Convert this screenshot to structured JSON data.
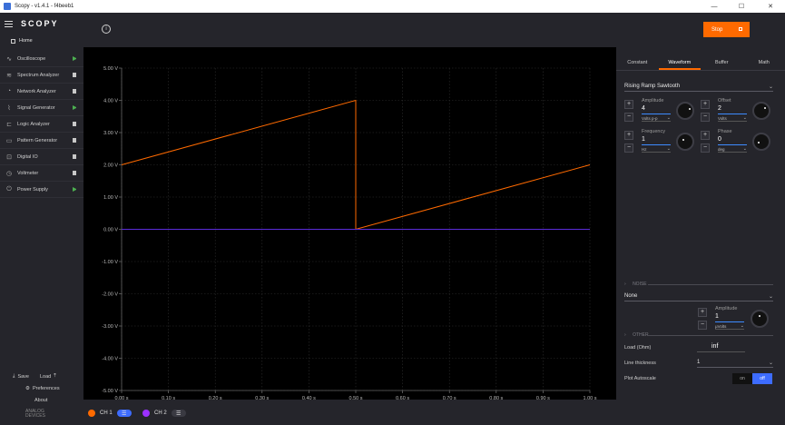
{
  "window": {
    "title": "Scopy - v1.4.1 - f4beeb1",
    "minimize": "—",
    "maximize": "☐",
    "close": "✕"
  },
  "sidebar": {
    "logo": "SCOPY",
    "home": "Home",
    "tools": [
      {
        "label": "Oscilloscope",
        "icon": "oscilloscope-icon",
        "status": "running"
      },
      {
        "label": "Spectrum Analyzer",
        "icon": "spectrum-icon",
        "status": "stopped"
      },
      {
        "label": "Network Analyzer",
        "icon": "network-icon",
        "status": "stopped"
      },
      {
        "label": "Signal Generator",
        "icon": "signal-icon",
        "status": "running"
      },
      {
        "label": "Logic Analyzer",
        "icon": "logic-icon",
        "status": "stopped"
      },
      {
        "label": "Pattern Generator",
        "icon": "pattern-icon",
        "status": "stopped"
      },
      {
        "label": "Digital IO",
        "icon": "digital-io-icon",
        "status": "stopped"
      },
      {
        "label": "Voltmeter",
        "icon": "voltmeter-icon",
        "status": "stopped"
      },
      {
        "label": "Power Supply",
        "icon": "power-icon",
        "status": "running"
      }
    ],
    "save": "Save",
    "load": "Load",
    "preferences": "Preferences",
    "about": "About",
    "brand_line1": "ANALOG",
    "brand_line2": "DEVICES"
  },
  "toolbar": {
    "stop_label": "Stop"
  },
  "chart_data": {
    "type": "line",
    "title": "",
    "xlabel": "",
    "ylabel": "",
    "xlim": [
      0,
      1.0
    ],
    "ylim": [
      -5,
      5
    ],
    "grid": true,
    "x_ticks": [
      "0.00 s",
      "0.10 s",
      "0.20 s",
      "0.30 s",
      "0.40 s",
      "0.50 s",
      "0.60 s",
      "0.70 s",
      "0.80 s",
      "0.90 s",
      "1.00 s"
    ],
    "y_ticks": [
      "5.00 V",
      "4.00 V",
      "3.00 V",
      "2.00 V",
      "1.00 V",
      "0.00 V",
      "-1.00 V",
      "-2.00 V",
      "-3.00 V",
      "-4.00 V",
      "-5.00 V"
    ],
    "series": [
      {
        "color": "#ff6a00",
        "x": [
          0,
          0.5,
          0.5,
          1.0
        ],
        "y": [
          2,
          4,
          0,
          2
        ]
      },
      {
        "color": "#5b2bd8",
        "x": [
          0,
          1.0
        ],
        "y": [
          0,
          0
        ]
      }
    ]
  },
  "panel": {
    "tabs": [
      "Constant",
      "Waveform",
      "Buffer",
      "Math"
    ],
    "active_tab": "Waveform",
    "waveform": "Rising Ramp Sawtooth",
    "amplitude": {
      "label": "Amplitude",
      "value": "4",
      "unit": "Volts p-p"
    },
    "offset": {
      "label": "Offset",
      "value": "2",
      "unit": "Volts"
    },
    "frequency": {
      "label": "Frequency",
      "value": "1",
      "unit": "Hz"
    },
    "phase": {
      "label": "Phase",
      "value": "0",
      "unit": "deg"
    },
    "noise_section": "NOISE",
    "noise_type": "None",
    "noise_amplitude": {
      "label": "Amplitude",
      "value": "1",
      "unit": "μVolts"
    },
    "other_section": "OTHER",
    "load_label": "Load (Ohm)",
    "load_value": "inf",
    "line_thickness_label": "Line thickness",
    "line_thickness_value": "1",
    "plot_autoscale_label": "Plot Autoscale",
    "autoscale_on": "on",
    "autoscale_off": "off"
  },
  "channels": [
    {
      "label": "CH 1",
      "color": "#ff6a00",
      "menu_color": "#3d6cff"
    },
    {
      "label": "CH 2",
      "color": "#9b30ff",
      "menu_color": "#3a3a42"
    }
  ]
}
